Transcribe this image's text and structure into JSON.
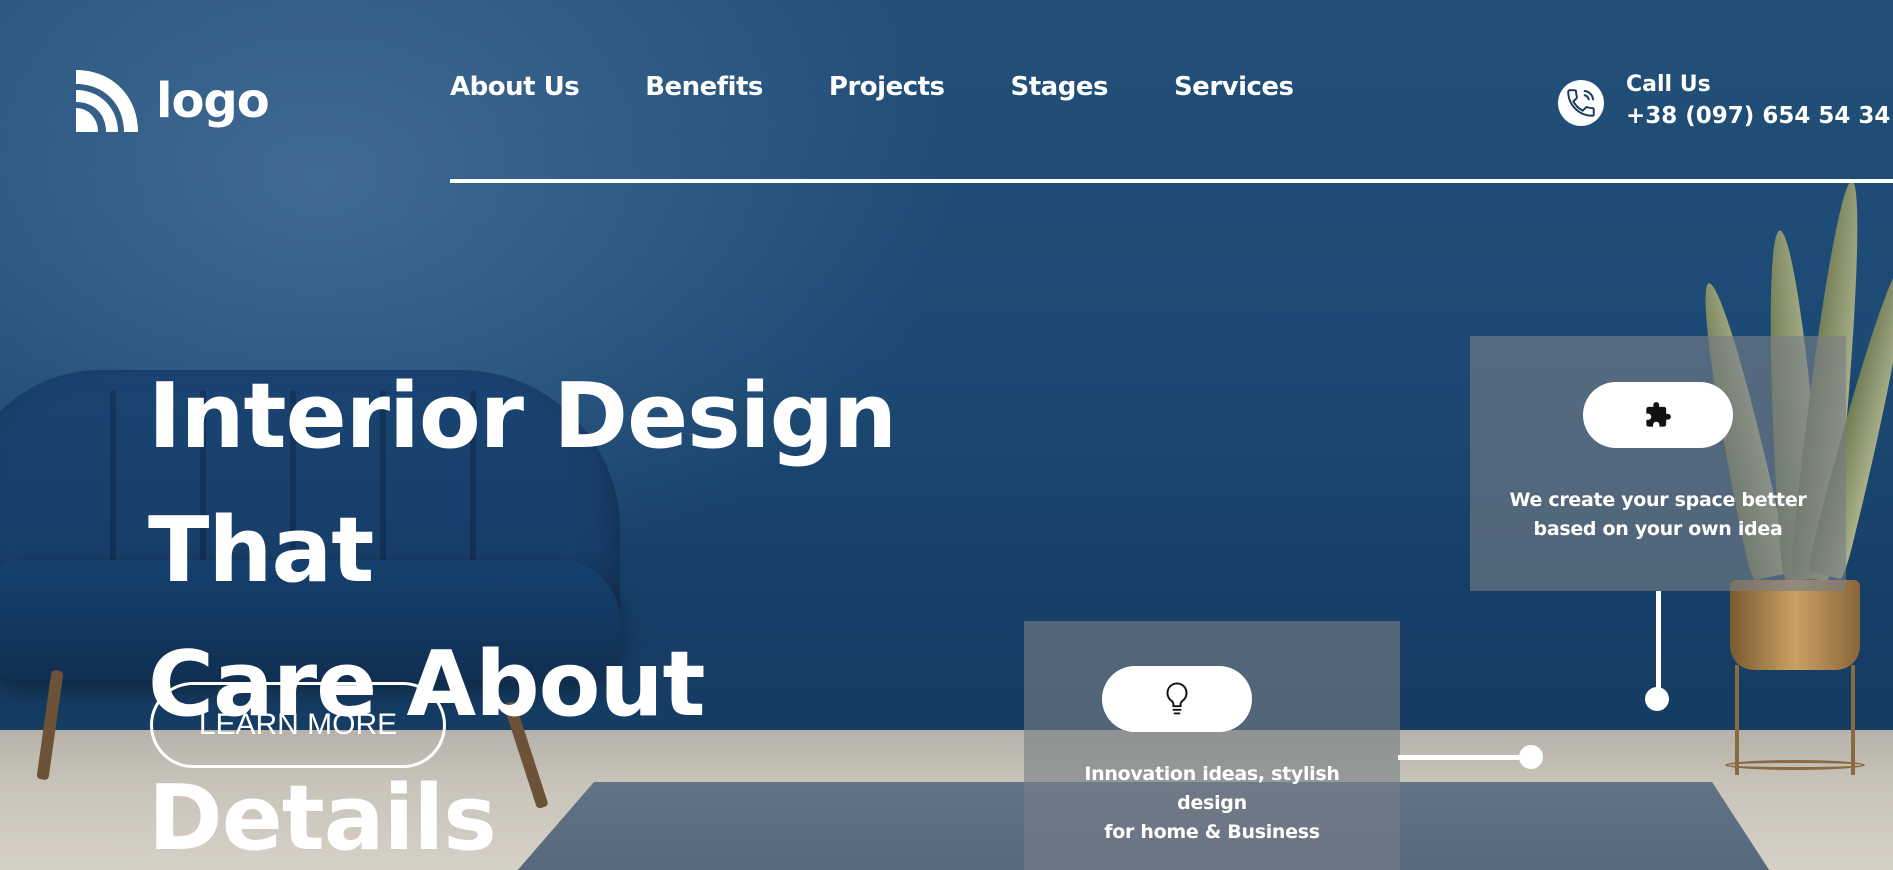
{
  "header": {
    "logo_text": "logo",
    "nav": [
      "About Us",
      "Benefits",
      "Projects",
      "Stages",
      "Services"
    ],
    "call_title": "Call Us",
    "call_phone": "+38 (097) 654 54 34"
  },
  "hero": {
    "headline_line1": "Interior Design That",
    "headline_line2": "Care About Details",
    "cta_label": "LEARN MORE"
  },
  "features": [
    {
      "icon": "puzzle-icon",
      "text_line1": "We create your space better",
      "text_line2": "based on your own idea"
    },
    {
      "icon": "lightbulb-icon",
      "text_line1": "Innovation ideas, stylish",
      "text_line2": "design",
      "text_line3": "for home & Business"
    }
  ],
  "colors": {
    "background": "#1c4a74",
    "text": "#ffffff",
    "card": "#787e86"
  }
}
